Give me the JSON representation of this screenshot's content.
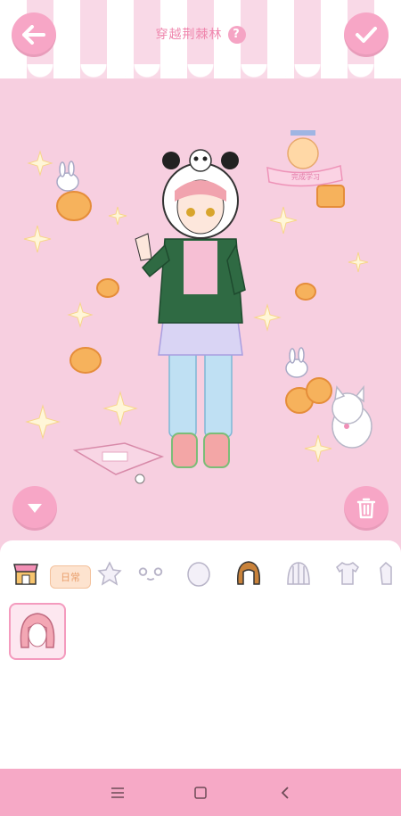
{
  "header": {
    "title": "穿越荆棘林",
    "help_label": "?"
  },
  "stage": {
    "banner_text": "完成学习"
  },
  "tabs": {
    "badge_label": "日常"
  },
  "colors": {
    "background": "#f7cfe0",
    "accent": "#f7a6c6",
    "navbar": "#f6a9c6"
  },
  "icons": [
    "back-icon",
    "check-icon",
    "chevron-down-icon",
    "trash-icon",
    "shop-icon",
    "eyes-icon",
    "face-icon",
    "hair-icon",
    "hat-icon",
    "shirt-icon",
    "jacket-icon",
    "menu-icon",
    "home-icon",
    "back-nav-icon"
  ]
}
